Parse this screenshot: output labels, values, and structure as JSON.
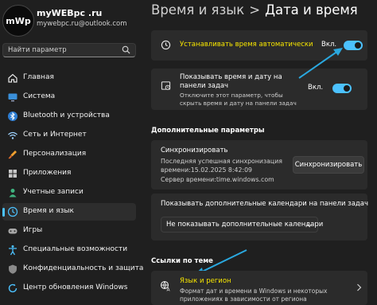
{
  "account": {
    "avatar_text": "mWp",
    "name": "myWEBpc .ru",
    "email": "mywebpc.ru@outlook.com"
  },
  "search": {
    "placeholder": "Найти параметр"
  },
  "sidebar": {
    "items": [
      {
        "label": "Главная",
        "icon": "home-icon"
      },
      {
        "label": "Система",
        "icon": "monitor-icon"
      },
      {
        "label": "Bluetooth и устройства",
        "icon": "bluetooth-icon"
      },
      {
        "label": "Сеть и Интернет",
        "icon": "wifi-icon"
      },
      {
        "label": "Персонализация",
        "icon": "brush-icon"
      },
      {
        "label": "Приложения",
        "icon": "apps-icon"
      },
      {
        "label": "Учетные записи",
        "icon": "person-icon"
      },
      {
        "label": "Время и язык",
        "icon": "globe-clock-icon"
      },
      {
        "label": "Игры",
        "icon": "gamepad-icon"
      },
      {
        "label": "Специальные возможности",
        "icon": "accessibility-icon"
      },
      {
        "label": "Конфиденциальность и защита",
        "icon": "shield-icon"
      },
      {
        "label": "Центр обновления Windows",
        "icon": "update-icon"
      }
    ],
    "active_index": 7
  },
  "header": {
    "parent": "Время и язык",
    "separator": ">",
    "current": "Дата и время"
  },
  "auto_time": {
    "label": "Устанавливать время автоматически",
    "state": "Вкл.",
    "on": true
  },
  "show_time": {
    "title": "Показывать время и дату на панели задач",
    "description": "Отключите этот параметр, чтобы скрыть время и дату на панели задач",
    "state": "Вкл.",
    "on": true
  },
  "additional": {
    "heading": "Дополнительные параметры",
    "sync": {
      "title": "Синхронизировать",
      "last_sync": "Последняя успешная синхронизация",
      "sync_time": "времени:15.02.2025 8:42:09",
      "server": "Сервер времени:time.windows.com",
      "button": "Синхронизировать"
    },
    "calendars": {
      "title": "Показывать дополнительные календари на панели задач",
      "selected": "Не показывать дополнительные календари"
    }
  },
  "related": {
    "heading": "Ссылки по теме",
    "region": {
      "title": "Язык и регион",
      "description": "Формат дат и времени в Windows и некоторых приложениях в зависимости от региона"
    }
  },
  "colors": {
    "accent": "#4cc2ff",
    "highlight_text": "#f7e600",
    "arrow": "#2aa8df"
  }
}
